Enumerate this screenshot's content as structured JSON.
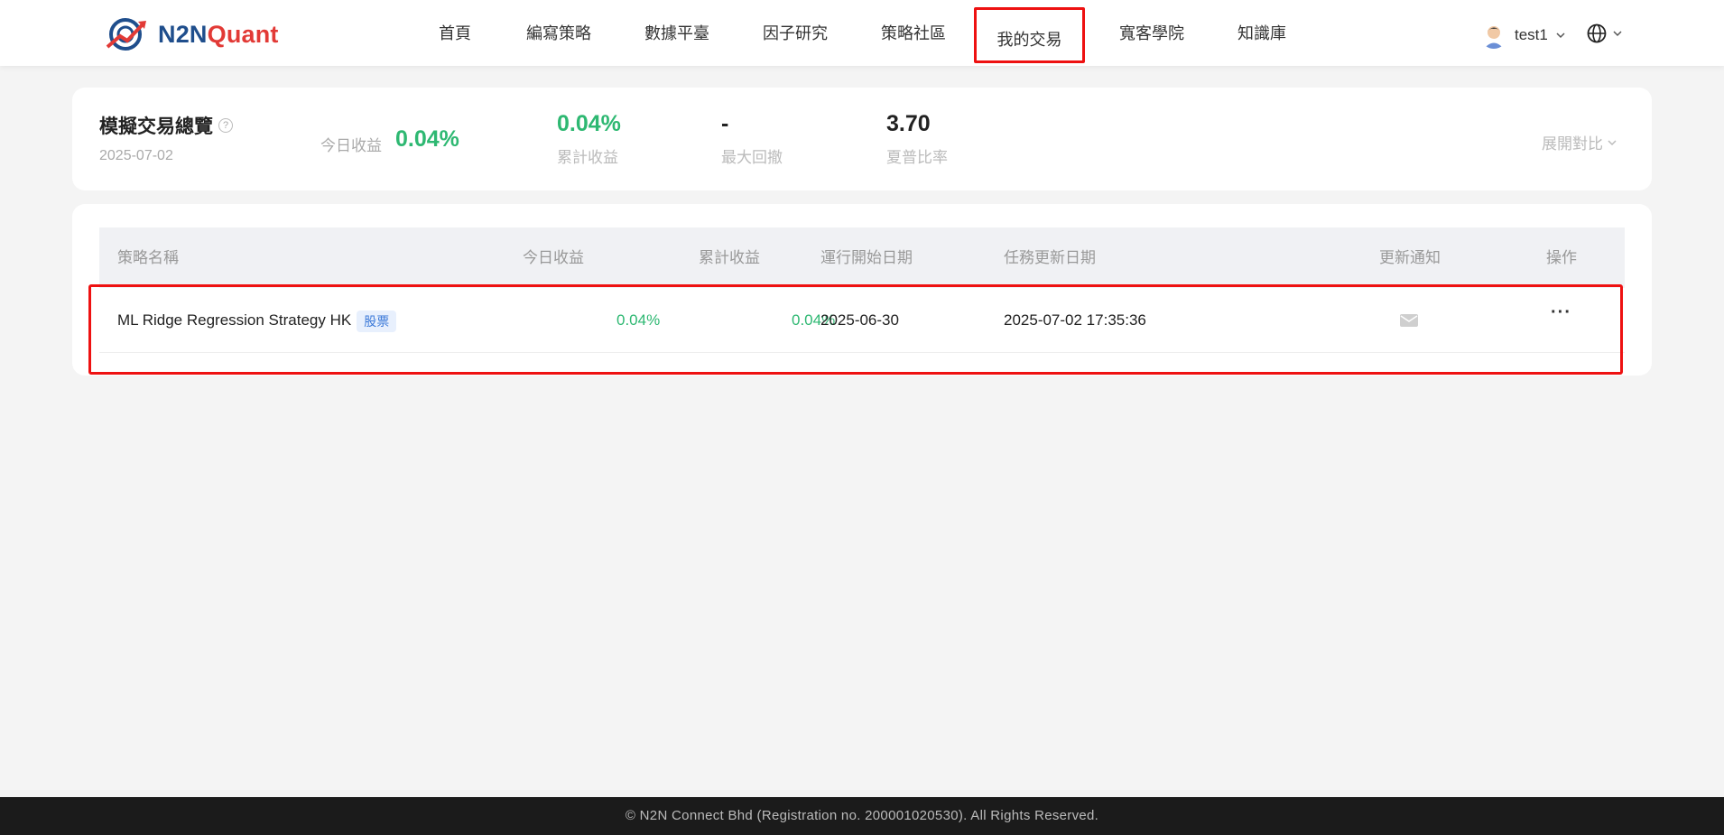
{
  "header": {
    "brand": {
      "part1": "N2N",
      "part2": "Quant"
    },
    "nav": [
      {
        "label": "首頁",
        "active": false
      },
      {
        "label": "編寫策略",
        "active": false
      },
      {
        "label": "數據平臺",
        "active": false
      },
      {
        "label": "因子研究",
        "active": false
      },
      {
        "label": "策略社區",
        "active": false
      },
      {
        "label": "我的交易",
        "active": true
      },
      {
        "label": "寬客學院",
        "active": false
      },
      {
        "label": "知識庫",
        "active": false
      }
    ],
    "user": {
      "name": "test1"
    },
    "icons": {
      "language": "globe-icon",
      "dropdown": "chevron-down-icon",
      "help": "question-icon"
    }
  },
  "summary": {
    "title": "模擬交易總覽",
    "date": "2025-07-02",
    "today_label": "今日收益",
    "today_value": "0.04%",
    "metrics": [
      {
        "value": "0.04%",
        "label": "累計收益",
        "color": "green"
      },
      {
        "value": "-",
        "label": "最大回撤",
        "color": "default"
      },
      {
        "value": "3.70",
        "label": "夏普比率",
        "color": "default"
      }
    ],
    "expand_label": "展開對比"
  },
  "table": {
    "columns": [
      "策略名稱",
      "今日收益",
      "累計收益",
      "運行開始日期",
      "任務更新日期",
      "更新通知",
      "操作"
    ],
    "rows": [
      {
        "name": "ML Ridge Regression Strategy HK",
        "tag": "股票",
        "today": "0.04%",
        "cumulative": "0.04%",
        "start_date": "2025-06-30",
        "update_date": "2025-07-02 17:35:36",
        "notify_icon": "mail-icon",
        "action": "···"
      }
    ]
  },
  "footer": {
    "text": "© N2N Connect Bhd (Registration no. 200001020530). All Rights Reserved."
  },
  "colors": {
    "green": "#2eb872",
    "highlight": "#ee1111",
    "brand_blue": "#1f4e8c",
    "brand_red": "#e23a36"
  }
}
